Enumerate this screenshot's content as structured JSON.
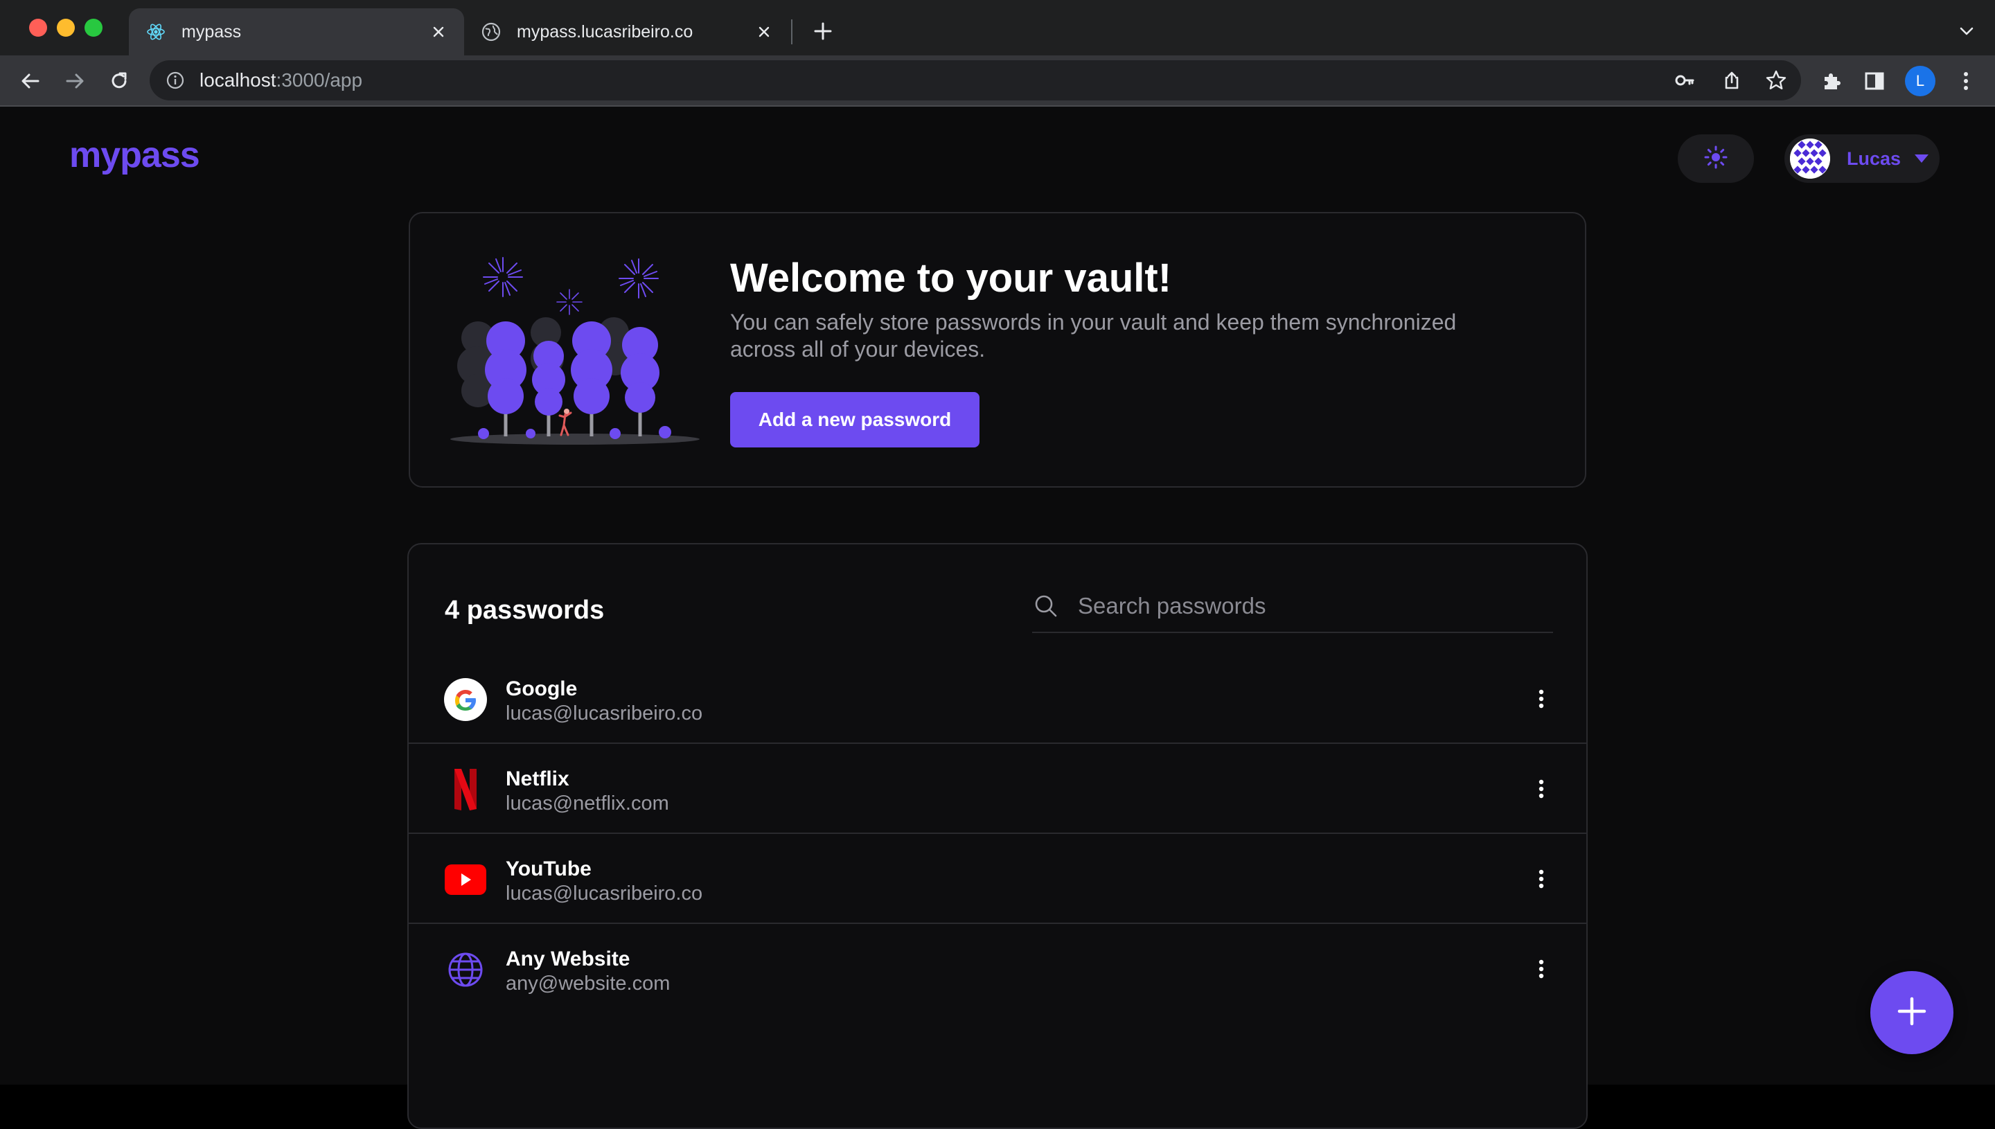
{
  "browser": {
    "tabs": [
      {
        "title": "mypass",
        "icon": "react-icon",
        "active": true
      },
      {
        "title": "mypass.lucasribeiro.co",
        "icon": "globe-icon",
        "active": false
      }
    ],
    "url_host": "localhost",
    "url_path": ":3000/app",
    "profile_initial": "L"
  },
  "app": {
    "logo": "mypass",
    "user": {
      "name": "Lucas"
    },
    "accent_color": "#6d4bf0"
  },
  "welcome": {
    "title": "Welcome to your vault!",
    "text": "You can safely store passwords in your vault and keep them synchronized across all of your devices.",
    "button_label": "Add a new password"
  },
  "vault": {
    "count_label": "4 passwords",
    "search_placeholder": "Search passwords",
    "items": [
      {
        "name": "Google",
        "email": "lucas@lucasribeiro.co",
        "icon": "google-icon"
      },
      {
        "name": "Netflix",
        "email": "lucas@netflix.com",
        "icon": "netflix-icon"
      },
      {
        "name": "YouTube",
        "email": "lucas@lucasribeiro.co",
        "icon": "youtube-icon"
      },
      {
        "name": "Any Website",
        "email": "any@website.com",
        "icon": "globe-icon"
      }
    ]
  }
}
